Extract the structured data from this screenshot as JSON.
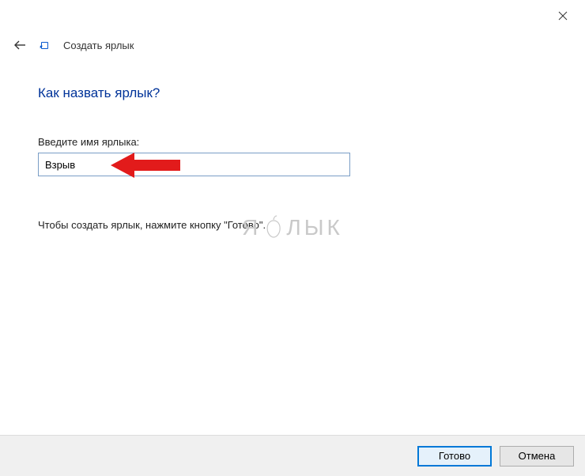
{
  "window": {
    "title": "Создать ярлык"
  },
  "heading": "Как назвать ярлык?",
  "field": {
    "label": "Введите имя ярлыка:",
    "value": "Взрыв"
  },
  "hint": "Чтобы создать ярлык, нажмите кнопку \"Готово\".",
  "buttons": {
    "finish": "Готово",
    "cancel": "Отмена"
  },
  "watermark": {
    "left": "Я",
    "right": "ЛЫК"
  }
}
